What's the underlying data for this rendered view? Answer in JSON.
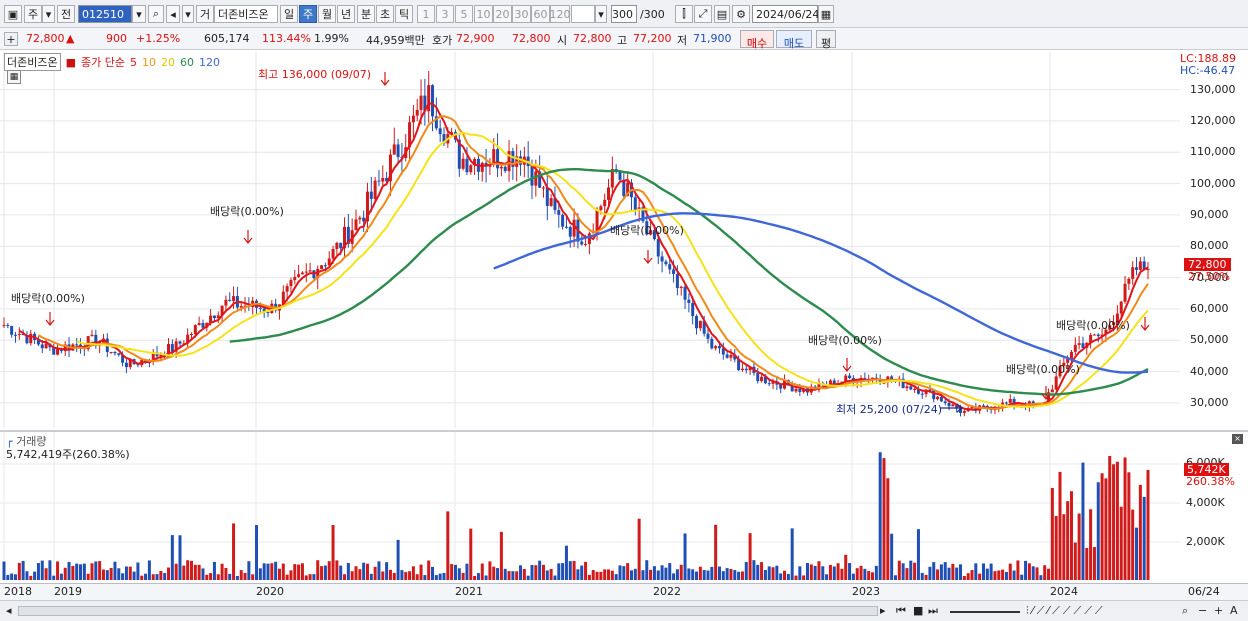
{
  "toolbar": {
    "period_label": "주",
    "prev_label": "전",
    "code_value": "012510",
    "mode_label": "거",
    "stock_name": "더존비즈온",
    "tf": [
      "일",
      "주",
      "월",
      "년",
      "분",
      "초",
      "틱"
    ],
    "tf_active": 1,
    "nums": [
      "1",
      "3",
      "5",
      "10",
      "20",
      "30",
      "60",
      "120"
    ],
    "count_value": "300",
    "count_total": "/300",
    "date_value": "2024/06/24"
  },
  "info": {
    "price": "72,800",
    "arrow": "▲",
    "change": "900",
    "change_pct": "+1.25%",
    "volume": "605,174",
    "vol_ratio": "113.44%",
    "turnover": "1.99%",
    "amount": "44,959백만",
    "ask_label": "호가",
    "ask1": "72,900",
    "ask2": "72,800",
    "open_label": "시",
    "open": "72,800",
    "high_label": "고",
    "high": "77,200",
    "low_label": "저",
    "low": "71,900",
    "buy_label": "매수",
    "sell_label": "매도",
    "avg_label": "평"
  },
  "legend": {
    "name": "더존비즈온",
    "ma_label": "종가 단순",
    "ma5": "5",
    "ma10": "10",
    "ma20": "20",
    "ma60": "60",
    "ma120": "120"
  },
  "annotations": {
    "high": "최고 136,000 (09/07)",
    "low": "최저 25,200 (07/24)",
    "dividend": "배당락(0.00%)"
  },
  "right_axis": {
    "lc": "LC:188.89",
    "hc": "HC:-46.47",
    "ticks": [
      "130,000",
      "120,000",
      "110,000",
      "100,000",
      "90,000",
      "80,000",
      "70,000",
      "60,000",
      "50,000",
      "40,000",
      "30,000"
    ],
    "price_tag": "72,800",
    "price_pct": "27.50%",
    "vol_ticks": [
      "6,000K",
      "4,000K",
      "2,000K"
    ],
    "vol_tag": "5,742K",
    "vol_pct": "260.38%"
  },
  "volume_panel": {
    "title": "거래량",
    "value": "5,742,419주(260.38%)"
  },
  "x_axis": [
    "2018",
    "2019",
    "2020",
    "2021",
    "2022",
    "2023",
    "2024"
  ],
  "x_axis_end": "06/24",
  "colors": {
    "up": "#d11a1a",
    "down": "#1f4fb5",
    "ma5": "#e3141a",
    "ma10": "#f08a18",
    "ma20": "#f5e21a",
    "ma60": "#2e8b4e",
    "ma120": "#3f67d8"
  },
  "chart_data": {
    "type": "candlestick",
    "title": "더존비즈온",
    "y_range": [
      22000,
      142000
    ],
    "weekly_close_points": [
      [
        "2018-06",
        55000
      ],
      [
        "2018-09",
        47000
      ],
      [
        "2018-12",
        50000
      ],
      [
        "2019-02",
        42000
      ],
      [
        "2019-05",
        48000
      ],
      [
        "2019-08",
        62000
      ],
      [
        "2019-11",
        60000
      ],
      [
        "2020-01",
        70000
      ],
      [
        "2020-03",
        78000
      ],
      [
        "2020-05",
        92000
      ],
      [
        "2020-07",
        110000
      ],
      [
        "2020-09",
        128000
      ],
      [
        "2020-11",
        108000
      ],
      [
        "2021-01",
        108000
      ],
      [
        "2021-03",
        110000
      ],
      [
        "2021-05",
        90000
      ],
      [
        "2021-07",
        83000
      ],
      [
        "2021-09",
        104000
      ],
      [
        "2021-11",
        83000
      ],
      [
        "2022-01",
        65000
      ],
      [
        "2022-03",
        48000
      ],
      [
        "2022-06",
        38000
      ],
      [
        "2022-09",
        34000
      ],
      [
        "2022-12",
        38000
      ],
      [
        "2023-02",
        38000
      ],
      [
        "2023-05",
        33000
      ],
      [
        "2023-07",
        27000
      ],
      [
        "2023-10",
        30000
      ],
      [
        "2023-12",
        29000
      ],
      [
        "2024-02",
        48000
      ],
      [
        "2024-04",
        52000
      ],
      [
        "2024-06",
        72800
      ]
    ],
    "ma120_start": "2021-01"
  }
}
